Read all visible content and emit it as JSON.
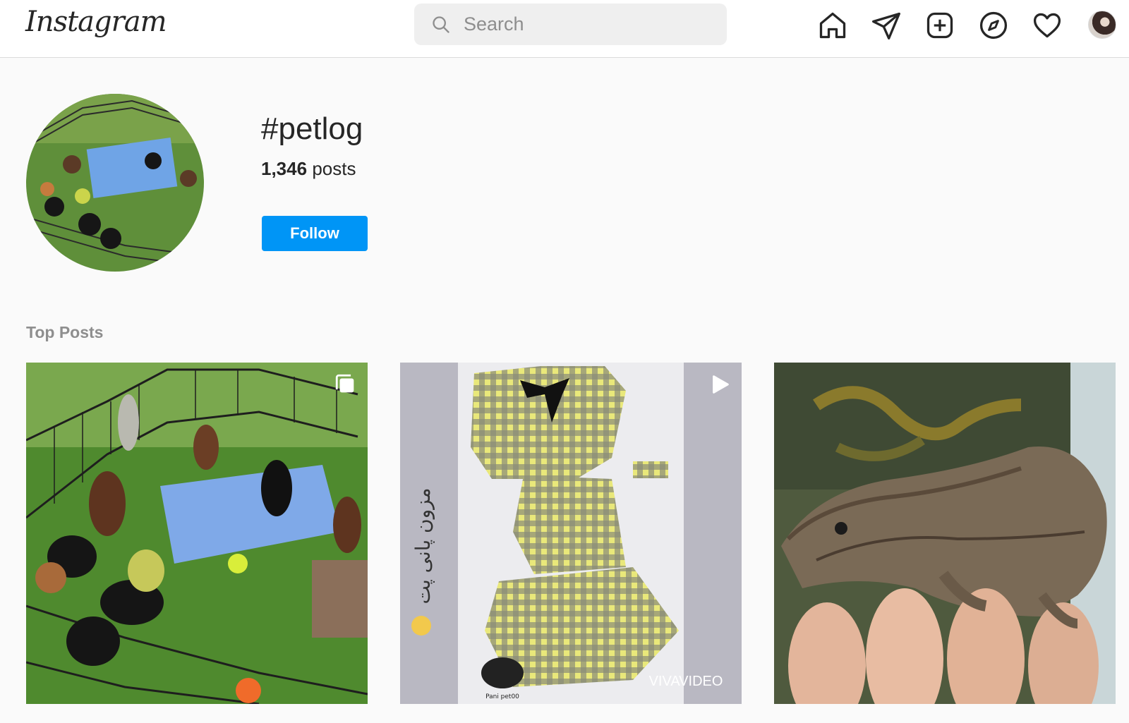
{
  "nav": {
    "logo": "Instagram",
    "search_placeholder": "Search",
    "icons": [
      "home-icon",
      "direct-icon",
      "new-post-icon",
      "explore-icon",
      "activity-icon",
      "profile-avatar"
    ]
  },
  "hashtag": {
    "title": "#petlog",
    "post_count": "1,346",
    "post_count_label": "posts",
    "follow_label": "Follow"
  },
  "top_posts": {
    "label": "Top Posts",
    "items": [
      {
        "kind": "carousel",
        "badge": "carousel-icon"
      },
      {
        "kind": "video",
        "badge": "video-icon",
        "overlay_text": "مزون پانی پت",
        "watermark": "VIVAVIDEO",
        "logo_text": "Pani pet00"
      },
      {
        "kind": "image"
      }
    ]
  },
  "colors": {
    "accent": "#0095f6",
    "muted": "#8e8e8e",
    "text": "#262626"
  }
}
